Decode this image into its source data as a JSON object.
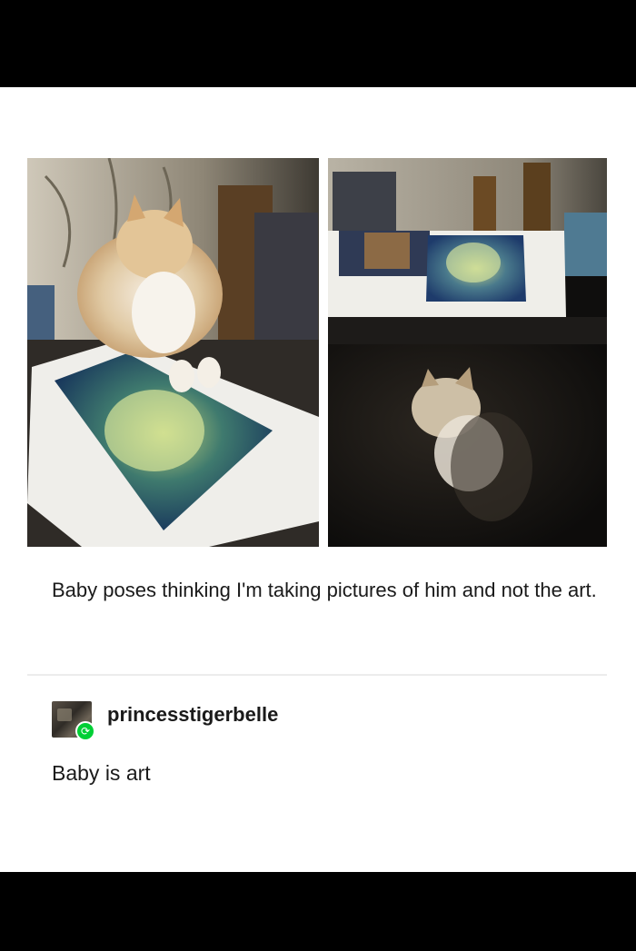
{
  "post": {
    "photos": [
      {
        "name": "photo-cat-on-painting"
      },
      {
        "name": "photo-cat-under-desk"
      }
    ],
    "caption": "Baby poses thinking I'm taking pictures of him and not the art."
  },
  "reblog": {
    "username": "princesstigerbelle",
    "badge_icon": "reblog-icon",
    "badge_color": "#00cf35",
    "comment": "Baby is art"
  }
}
